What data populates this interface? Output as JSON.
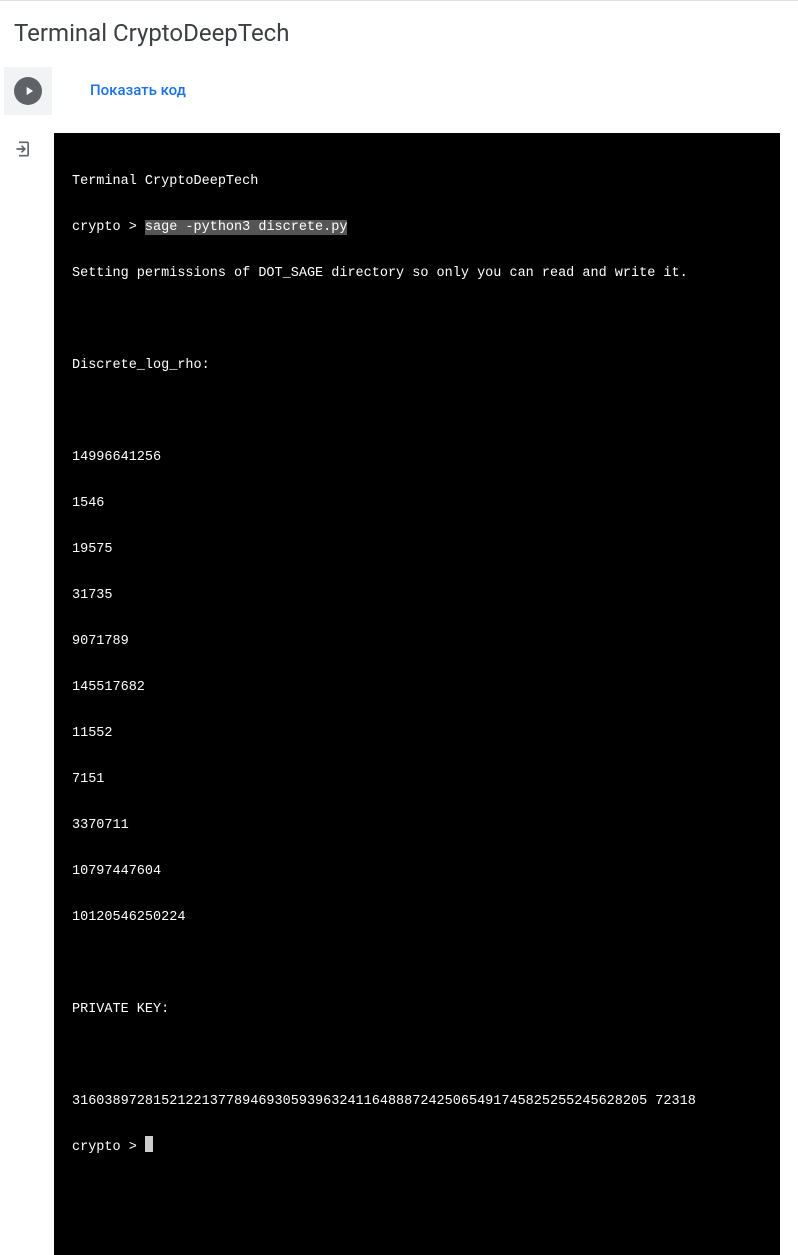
{
  "header": {
    "title": "Terminal CryptoDeepTech"
  },
  "cell": {
    "show_code_label": "Показать код"
  },
  "terminal": {
    "header_line": "Terminal CryptoDeepTech",
    "prompt": "crypto > ",
    "command": "sage -python3 discrete.py",
    "permissions_line": "Setting permissions of DOT_SAGE directory so only you can read and write it.",
    "section1_title": "Discrete_log_rho:",
    "values": [
      "14996641256",
      "1546",
      "19575",
      "31735",
      "9071789",
      "145517682",
      "11552",
      "7151",
      "3370711",
      "10797447604",
      "10120546250224"
    ],
    "section2_title": "PRIVATE KEY:",
    "private_key": "31603897281521221377894693059396324116488872425065491745825255245628205 72318",
    "prompt2": "crypto > "
  }
}
